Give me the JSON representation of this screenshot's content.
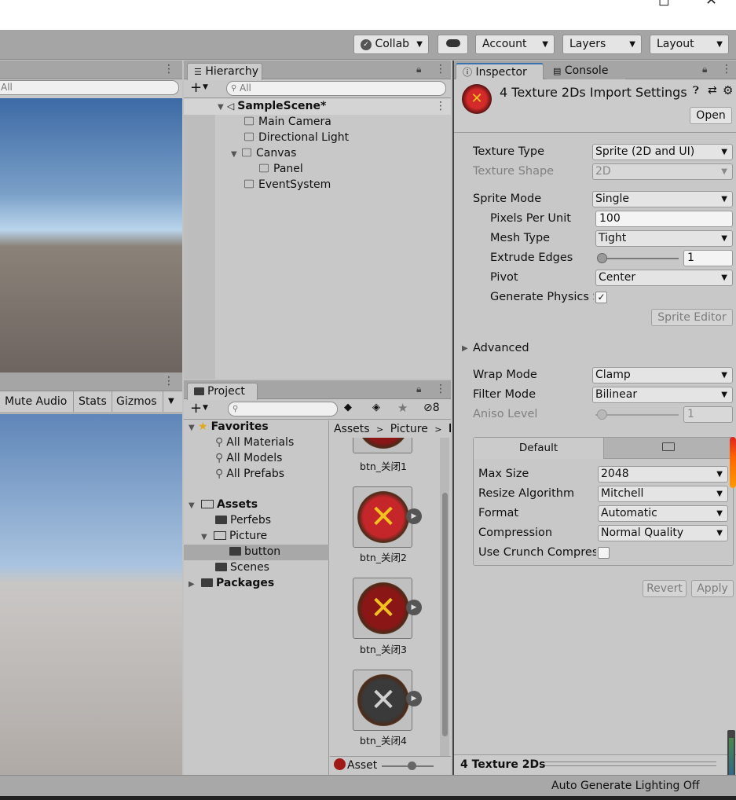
{
  "toolbar": {
    "collab": "Collab",
    "account": "Account",
    "layers": "Layers",
    "layout": "Layout"
  },
  "scene": {
    "search_placeholder": "All"
  },
  "game": {
    "mute_audio": "Mute Audio",
    "stats": "Stats",
    "gizmos": "Gizmos"
  },
  "hierarchy": {
    "tab": "Hierarchy",
    "search_placeholder": "All",
    "items": [
      {
        "label": "SampleScene*"
      },
      {
        "label": "Main Camera"
      },
      {
        "label": "Directional Light"
      },
      {
        "label": "Canvas"
      },
      {
        "label": "Panel"
      },
      {
        "label": "EventSystem"
      }
    ]
  },
  "project": {
    "tab": "Project",
    "hidden_count": "8",
    "tree": [
      {
        "label": "Favorites"
      },
      {
        "label": "All Materials"
      },
      {
        "label": "All Models"
      },
      {
        "label": "All Prefabs"
      },
      {
        "label": "Assets"
      },
      {
        "label": "Perfebs"
      },
      {
        "label": "Picture"
      },
      {
        "label": "button"
      },
      {
        "label": "Scenes"
      },
      {
        "label": "Packages"
      }
    ],
    "breadcrumb": {
      "a": "Assets",
      "b": "Picture",
      "c": "b"
    },
    "assets": [
      {
        "label": "btn_关闭1",
        "color": "#8a1616"
      },
      {
        "label": "btn_关闭2",
        "color": "#c4262a"
      },
      {
        "label": "btn_关闭3",
        "color": "#8a1616"
      },
      {
        "label": "btn_关闭4",
        "color": "#3a3a3a"
      }
    ],
    "footer": "Asset"
  },
  "inspector": {
    "tab": "Inspector",
    "console_tab": "Console",
    "title": "4 Texture 2Ds Import Settings",
    "open": "Open",
    "rows": {
      "texture_type": {
        "label": "Texture Type",
        "value": "Sprite (2D and UI)"
      },
      "texture_shape": {
        "label": "Texture Shape",
        "value": "2D"
      },
      "sprite_mode": {
        "label": "Sprite Mode",
        "value": "Single"
      },
      "ppu": {
        "label": "Pixels Per Unit",
        "value": "100"
      },
      "mesh_type": {
        "label": "Mesh Type",
        "value": "Tight"
      },
      "extrude": {
        "label": "Extrude Edges",
        "value": "1"
      },
      "pivot": {
        "label": "Pivot",
        "value": "Center"
      },
      "gen_physics": {
        "label": "Generate Physics S",
        "value": "✓"
      },
      "wrap": {
        "label": "Wrap Mode",
        "value": "Clamp"
      },
      "filter": {
        "label": "Filter Mode",
        "value": "Bilinear"
      },
      "aniso": {
        "label": "Aniso Level",
        "value": "1"
      }
    },
    "sprite_editor": "Sprite Editor",
    "advanced": "Advanced",
    "platform": {
      "default_tab": "Default",
      "max_size": {
        "label": "Max Size",
        "value": "2048"
      },
      "resize": {
        "label": "Resize Algorithm",
        "value": "Mitchell"
      },
      "format": {
        "label": "Format",
        "value": "Automatic"
      },
      "compression": {
        "label": "Compression",
        "value": "Normal Quality"
      },
      "crunch": {
        "label": "Use Crunch Compres"
      }
    },
    "revert": "Revert",
    "apply": "Apply",
    "footer": "4 Texture 2Ds"
  },
  "status": {
    "text": "Auto Generate Lighting Off"
  }
}
